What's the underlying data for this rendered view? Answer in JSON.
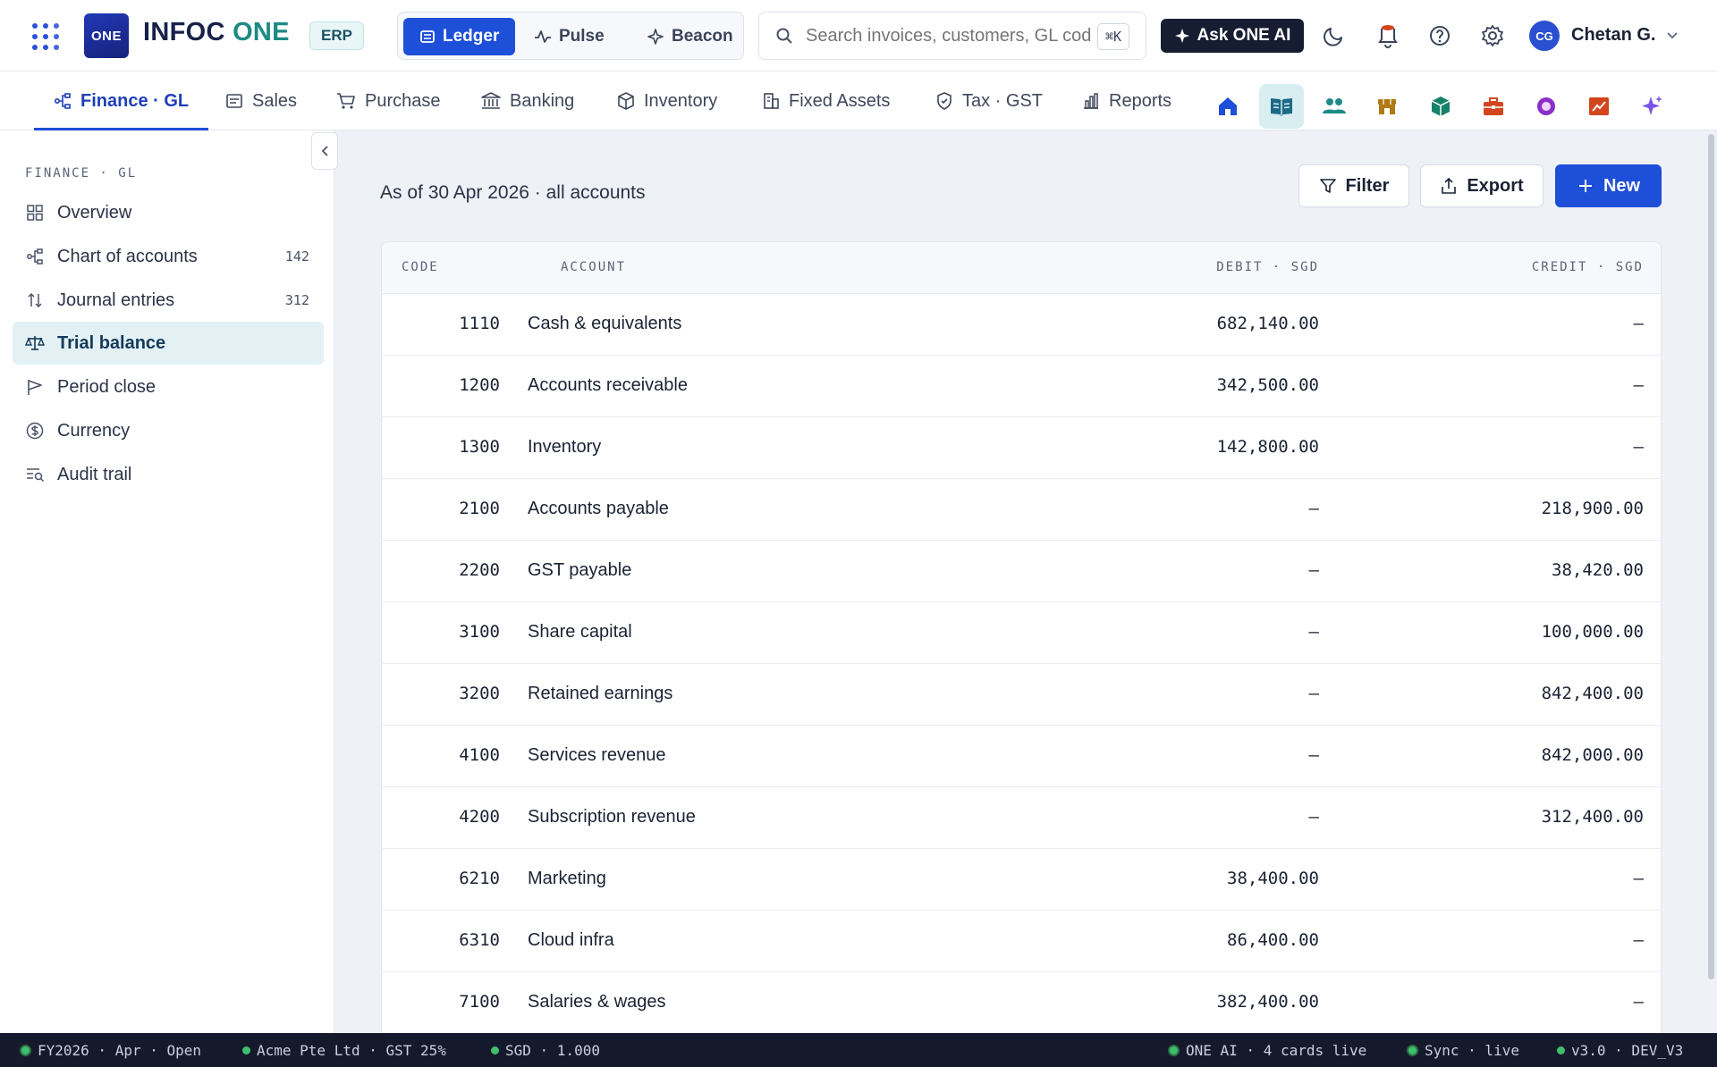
{
  "app": {
    "logo_text": "ONE",
    "brand_part1": "INFOC",
    "brand_part2": "ONE",
    "badge": "ERP"
  },
  "workspace_switch": [
    {
      "label": "Ledger",
      "icon": "ledger-icon",
      "active": true
    },
    {
      "label": "Pulse",
      "icon": "pulse-icon",
      "active": false
    },
    {
      "label": "Beacon",
      "icon": "sparkle-icon",
      "active": false
    }
  ],
  "search": {
    "placeholder": "Search invoices, customers, GL codes…",
    "shortcut": "⌘K"
  },
  "ask_ai": {
    "label": "Ask ONE AI"
  },
  "user": {
    "initials": "CG",
    "name": "Chetan G."
  },
  "module_tabs": [
    {
      "label": "Finance · GL",
      "icon": "gl-icon",
      "active": true
    },
    {
      "label": "Sales",
      "icon": "sales-icon"
    },
    {
      "label": "Purchase",
      "icon": "cart-icon"
    },
    {
      "label": "Banking",
      "icon": "bank-icon"
    },
    {
      "label": "Inventory",
      "icon": "box-icon"
    },
    {
      "label": "Fixed Assets",
      "icon": "building-icon"
    },
    {
      "label": "Tax · GST",
      "icon": "shield-icon"
    },
    {
      "label": "Reports",
      "icon": "bar-chart-icon"
    }
  ],
  "app_launcher": [
    {
      "name": "home-app-icon",
      "color": "#1d4fd8"
    },
    {
      "name": "ledger-app-icon",
      "color": "#1b6a86",
      "active": true
    },
    {
      "name": "people-app-icon",
      "color": "#1d8a86"
    },
    {
      "name": "store-app-icon",
      "color": "#b07a12"
    },
    {
      "name": "package-app-icon",
      "color": "#16826a"
    },
    {
      "name": "briefcase-app-icon",
      "color": "#d2461e"
    },
    {
      "name": "circle-app-icon",
      "color": "#8a2fc8"
    },
    {
      "name": "trend-app-icon",
      "color": "#d2461e"
    },
    {
      "name": "sparkle-app-icon",
      "color": "#7a52e8"
    }
  ],
  "sidebar": {
    "heading": "FINANCE · GL",
    "items": [
      {
        "label": "Overview",
        "icon": "grid-icon",
        "count": ""
      },
      {
        "label": "Chart of accounts",
        "icon": "tree-icon",
        "count": "142"
      },
      {
        "label": "Journal entries",
        "icon": "sort-arrows-icon",
        "count": "312"
      },
      {
        "label": "Trial balance",
        "icon": "scale-icon",
        "count": "",
        "active": true
      },
      {
        "label": "Period close",
        "icon": "flag-icon",
        "count": ""
      },
      {
        "label": "Currency",
        "icon": "dollar-circle-icon",
        "count": ""
      },
      {
        "label": "Audit trail",
        "icon": "list-search-icon",
        "count": ""
      }
    ]
  },
  "main": {
    "subtitle": "As of 30 Apr 2026 · all accounts",
    "filter_label": "Filter",
    "export_label": "Export",
    "new_label": "New"
  },
  "table": {
    "headers": {
      "code": "CODE",
      "account": "ACCOUNT",
      "debit": "DEBIT · SGD",
      "credit": "CREDIT · SGD"
    },
    "rows": [
      {
        "code": "1110",
        "account": "Cash & equivalents",
        "debit": "682,140.00",
        "credit": "—"
      },
      {
        "code": "1200",
        "account": "Accounts receivable",
        "debit": "342,500.00",
        "credit": "—"
      },
      {
        "code": "1300",
        "account": "Inventory",
        "debit": "142,800.00",
        "credit": "—"
      },
      {
        "code": "2100",
        "account": "Accounts payable",
        "debit": "—",
        "credit": "218,900.00"
      },
      {
        "code": "2200",
        "account": "GST payable",
        "debit": "—",
        "credit": "38,420.00"
      },
      {
        "code": "3100",
        "account": "Share capital",
        "debit": "—",
        "credit": "100,000.00"
      },
      {
        "code": "3200",
        "account": "Retained earnings",
        "debit": "—",
        "credit": "842,400.00"
      },
      {
        "code": "4100",
        "account": "Services revenue",
        "debit": "—",
        "credit": "842,000.00"
      },
      {
        "code": "4200",
        "account": "Subscription revenue",
        "debit": "—",
        "credit": "312,400.00"
      },
      {
        "code": "6210",
        "account": "Marketing",
        "debit": "38,400.00",
        "credit": "—"
      },
      {
        "code": "6310",
        "account": "Cloud infra",
        "debit": "86,400.00",
        "credit": "—"
      },
      {
        "code": "7100",
        "account": "Salaries & wages",
        "debit": "382,400.00",
        "credit": "—"
      }
    ]
  },
  "status_bar": {
    "left": [
      "FY2026 · Apr · Open",
      "Acme Pte Ltd · GST 25%",
      "SGD · 1.000"
    ],
    "right": [
      "ONE AI · 4 cards live",
      "Sync · live",
      "v3.0 · DEV_V3"
    ]
  },
  "colors": {
    "accent": "#1d4fd8",
    "brand_teal": "#1d8a86",
    "status_ok": "#3fbf6e"
  }
}
